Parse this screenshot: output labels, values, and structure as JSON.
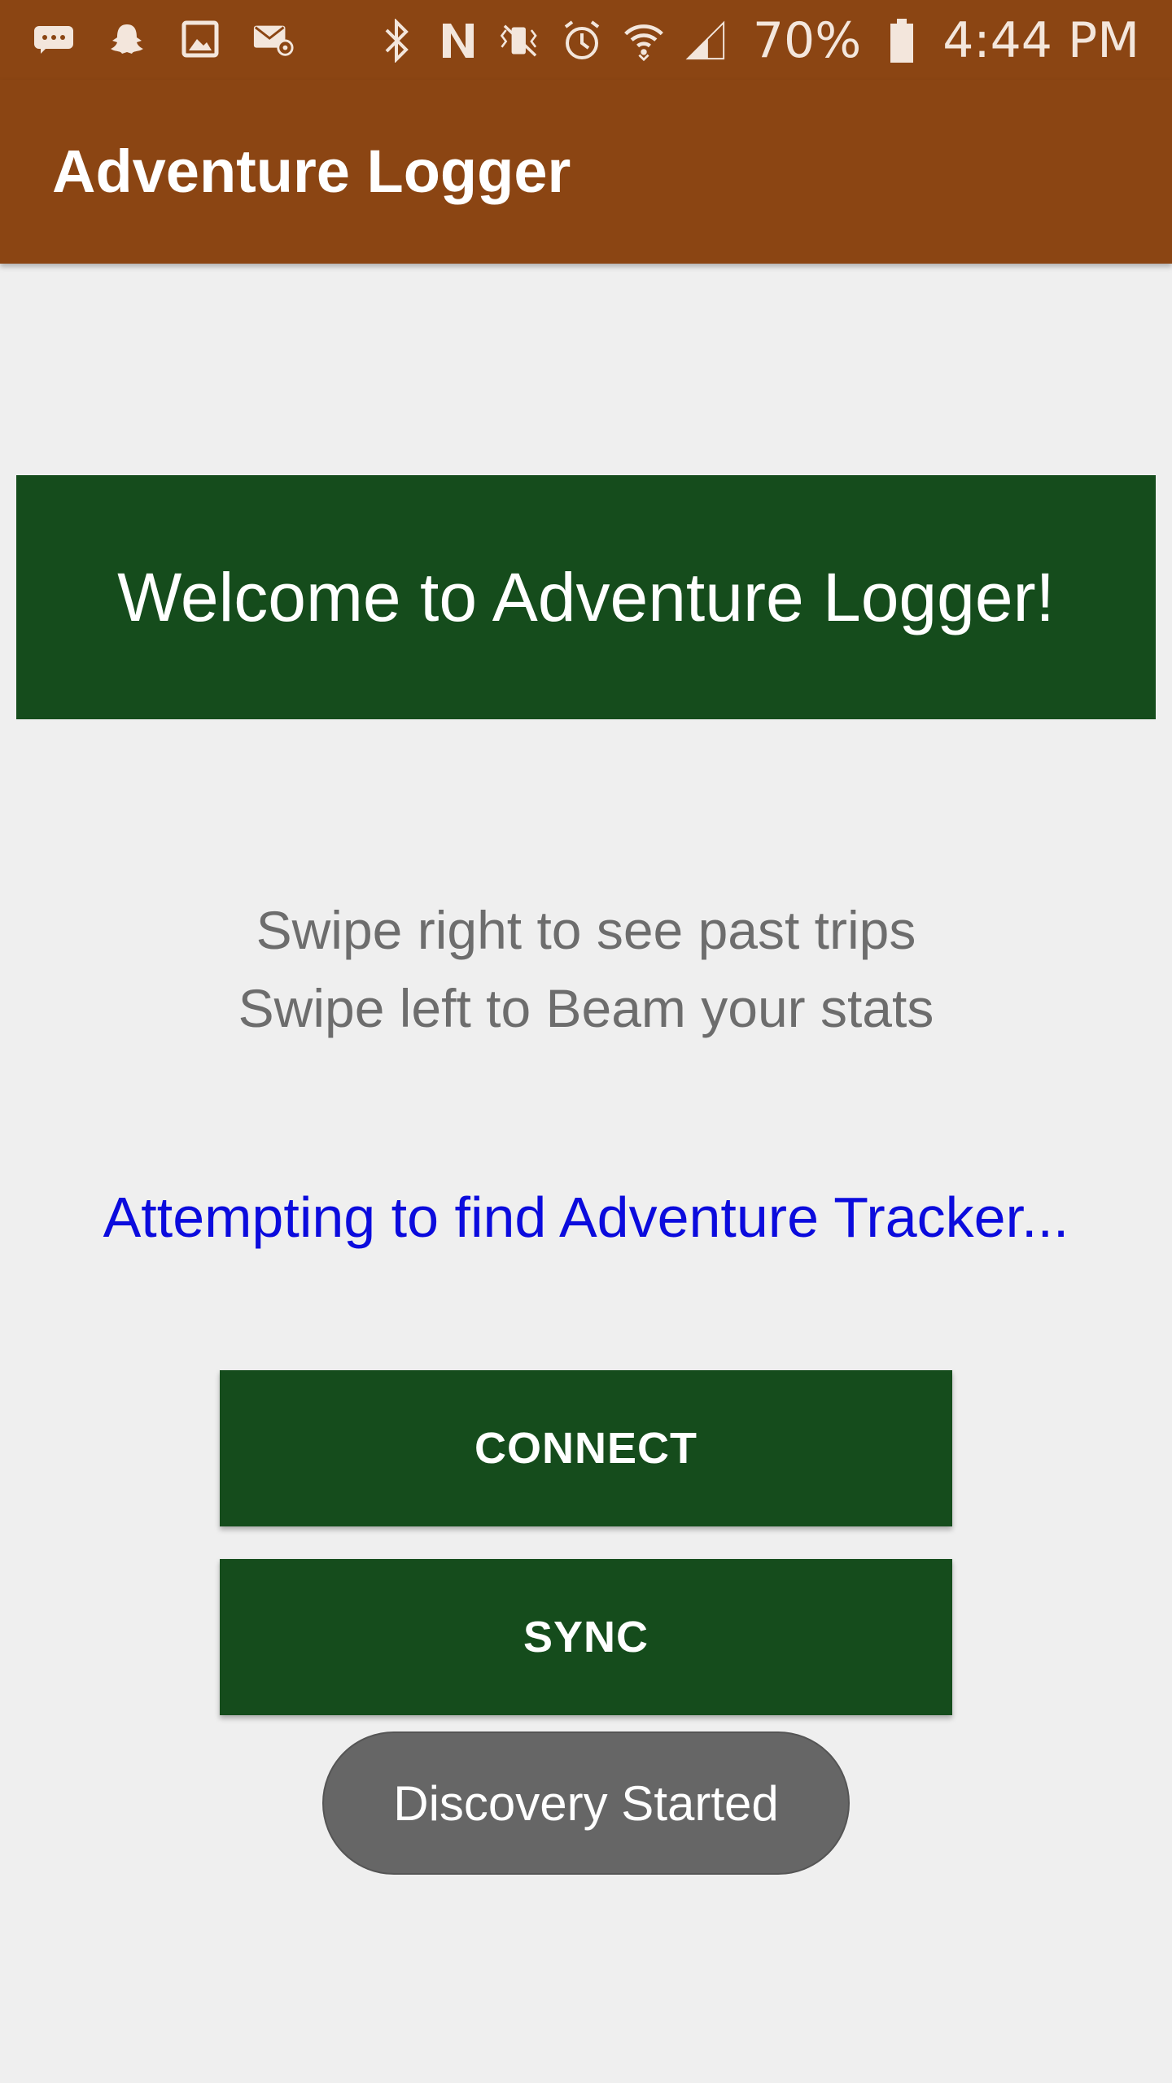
{
  "status_bar": {
    "left_icons": [
      "message-icon",
      "snapchat-icon",
      "gallery-icon",
      "email-icon"
    ],
    "right_icons": [
      "bluetooth-icon",
      "nfc-icon",
      "vibrate-icon",
      "alarm-icon",
      "wifi-icon",
      "signal-icon"
    ],
    "battery_percent": "70%",
    "time": "4:44 PM"
  },
  "app_bar": {
    "title": "Adventure Logger"
  },
  "main": {
    "welcome": "Welcome to Adventure Logger!",
    "instruction_line1": "Swipe right to see past trips",
    "instruction_line2": "Swipe left to Beam your stats",
    "status_message": "Attempting to find Adventure Tracker...",
    "connect_label": "CONNECT",
    "sync_label": "SYNC"
  },
  "toast": {
    "text": "Discovery Started"
  },
  "colors": {
    "primary_brown": "#8b4513",
    "primary_green": "#154c1c",
    "status_blue": "#0b0bdd",
    "background": "#efefef"
  }
}
